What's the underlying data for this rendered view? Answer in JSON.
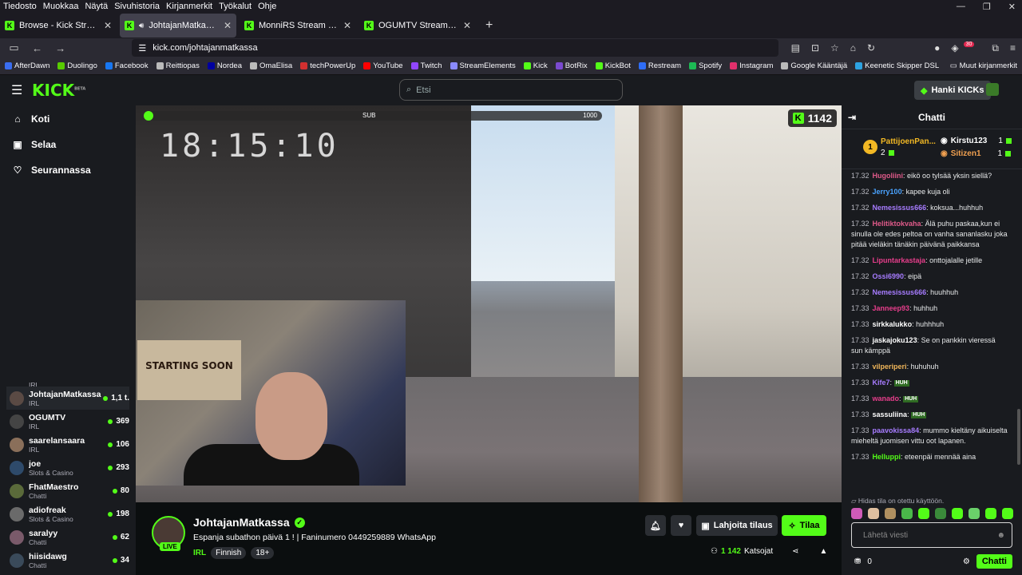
{
  "os_menu": [
    "Tiedosto",
    "Muokkaa",
    "Näytä",
    "Sivuhistoria",
    "Kirjanmerkit",
    "Työkalut",
    "Ohje"
  ],
  "window_controls": {
    "minimize": "—",
    "maximize": "❐",
    "close": "✕"
  },
  "tabs": [
    {
      "title": "Browse - Kick Streaming",
      "active": false
    },
    {
      "title": "JohtajanMatkassa Stream - ",
      "active": true
    },
    {
      "title": "MonniRS Stream - Watch L",
      "active": false
    },
    {
      "title": "OGUMTV Stream - Watch Live c",
      "active": false
    }
  ],
  "browser": {
    "url": "kick.com/johtajanmatkassa",
    "notification_count": "30"
  },
  "bookmarks": [
    {
      "label": "AfterDawn",
      "color": "#3a6df0"
    },
    {
      "label": "Duolingo",
      "color": "#58cc02"
    },
    {
      "label": "Facebook",
      "color": "#1877f2"
    },
    {
      "label": "Reittiopas",
      "color": "#bbbbbb"
    },
    {
      "label": "Nordea",
      "color": "#0000a0"
    },
    {
      "label": "OmaElisa",
      "color": "#bbbbbb"
    },
    {
      "label": "techPowerUp",
      "color": "#d23030"
    },
    {
      "label": "YouTube",
      "color": "#ff0000"
    },
    {
      "label": "Twitch",
      "color": "#9146ff"
    },
    {
      "label": "StreamElements",
      "color": "#8a8aff"
    },
    {
      "label": "Kick",
      "color": "#53fc18"
    },
    {
      "label": "BotRix",
      "color": "#7a4ad0"
    },
    {
      "label": "KickBot",
      "color": "#53fc18"
    },
    {
      "label": "Restream",
      "color": "#2f6df6"
    },
    {
      "label": "Spotify",
      "color": "#1db954"
    },
    {
      "label": "Instagram",
      "color": "#e1306c"
    },
    {
      "label": "Google Kääntäjä",
      "color": "#bbbbbb"
    },
    {
      "label": "Keenetic Skipper DSL",
      "color": "#2da2e1"
    }
  ],
  "bookmarks_other": "Muut kirjanmerkit",
  "kick": {
    "logo": "KICK",
    "logo_sup": "BETA",
    "search_placeholder": "Etsi",
    "get_kicks": "Hanki KICKs"
  },
  "sidebar": {
    "nav": [
      {
        "label": "Koti",
        "icon": "home-icon",
        "glyph": "⌂"
      },
      {
        "label": "Selaa",
        "icon": "browse-icon",
        "glyph": "▣"
      },
      {
        "label": "Seurannassa",
        "icon": "heart-icon",
        "glyph": "♡"
      }
    ],
    "channels": [
      {
        "name": "",
        "category": "IRL",
        "viewers": ""
      },
      {
        "name": "JohtajanMatkassa",
        "category": "IRL",
        "viewers": "1,1 t."
      },
      {
        "name": "OGUMTV",
        "category": "IRL",
        "viewers": "369"
      },
      {
        "name": "saarelansaara",
        "category": "IRL",
        "viewers": "106"
      },
      {
        "name": "joe",
        "category": "Slots & Casino",
        "viewers": "293"
      },
      {
        "name": "FhatMaestro",
        "category": "Chatti",
        "viewers": "80"
      },
      {
        "name": "adiofreak",
        "category": "Slots & Casino",
        "viewers": "198"
      },
      {
        "name": "saralyy",
        "category": "Chatti",
        "viewers": "62"
      },
      {
        "name": "hiisidawg",
        "category": "Chatti",
        "viewers": "34"
      }
    ]
  },
  "video": {
    "sub_label": "SUB",
    "sub_max": "1000",
    "sub_progress": 0.006,
    "clock": "18:15:10",
    "kick_count": "1142",
    "poster_text": "STARTING SOON"
  },
  "stream": {
    "name": "JohtajanMatkassa",
    "title": "Espanja subathon päivä 1 ! | Faninumero 0449259889 WhatsApp",
    "category": "IRL",
    "tags": [
      "Finnish",
      "18+"
    ],
    "live": "LIVE",
    "gift_label": "Lahjoita tilaus",
    "subscribe_label": "Tilaa",
    "viewers_count": "1 142",
    "viewers_label": "Katsojat"
  },
  "chat": {
    "title": "Chatti",
    "top_gifters": [
      {
        "name": "PattijoenPan...",
        "count": "2"
      },
      {
        "name": "Kirstu123",
        "count": "1"
      },
      {
        "name": "Sitizen1",
        "count": "1"
      }
    ],
    "rank": "1",
    "messages": [
      {
        "time": "17.32",
        "user": "Hugoliini",
        "color": "#e05a8a",
        "text": "eikö oo tylsää yksin siellä?"
      },
      {
        "time": "17.32",
        "user": "Jerry100",
        "color": "#4aa3ff",
        "text": "kapee kuja oli"
      },
      {
        "time": "17.32",
        "user": "Nemesissus666",
        "color": "#a77cff",
        "text": "koksua...huhhuh"
      },
      {
        "time": "17.32",
        "user": "Helitiktokvaha",
        "color": "#e05a8a",
        "text": "Älä puhu paskaa,kun ei sinulla ole edes peltoa on vanha sananlasku joka pitää vieläkin tänäkin päivänä paikkansa"
      },
      {
        "time": "17.32",
        "user": "Lipuntarkastaja",
        "color": "#e83e8c",
        "text": "onttojalalle jetille"
      },
      {
        "time": "17.32",
        "user": "Ossi6990",
        "color": "#a77cff",
        "text": "eipä"
      },
      {
        "time": "17.32",
        "user": "Nemesissus666",
        "color": "#a77cff",
        "text": "huuhhuh"
      },
      {
        "time": "17.33",
        "user": "Janneep93",
        "color": "#e83e8c",
        "text": "huhhuh"
      },
      {
        "time": "17.33",
        "user": "sirkkalukko",
        "color": "#ffffff",
        "text": "huhhhuh"
      },
      {
        "time": "17.33",
        "user": "jaskajoku123",
        "color": "#ffffff",
        "text": "Se on pankkin vieressä sun kämppä"
      },
      {
        "time": "17.33",
        "user": "vilperiperi",
        "color": "#f0b65a",
        "text": "huhuhuh"
      },
      {
        "time": "17.33",
        "user": "Kife7",
        "color": "#a77cff",
        "text": "HUH"
      },
      {
        "time": "17.33",
        "user": "wanado",
        "color": "#e83e8c",
        "text": "HUH"
      },
      {
        "time": "17.33",
        "user": "sassuliina",
        "color": "#ffffff",
        "text": "HUH"
      },
      {
        "time": "17.33",
        "user": "paavokissa84",
        "color": "#a77cff",
        "text": "mummo kieltäny aikuiselta mieheltä juomisen vittu oot lapanen."
      },
      {
        "time": "17.33",
        "user": "Helluppi",
        "color": "#53fc18",
        "text": "eteenpäi mennää aina"
      }
    ],
    "slow_mode": "Hidas tila on otettu käyttöön.",
    "input_placeholder": "Lähetä viesti",
    "points": "0",
    "send_label": "Chatti",
    "emote_colors": [
      "#d05bb8",
      "#e0c0a0",
      "#b09060",
      "#4ab84a",
      "#53fc18",
      "#3a8a3a",
      "#53fc18",
      "#6ad06a",
      "#53fc18",
      "#53fc18"
    ]
  }
}
